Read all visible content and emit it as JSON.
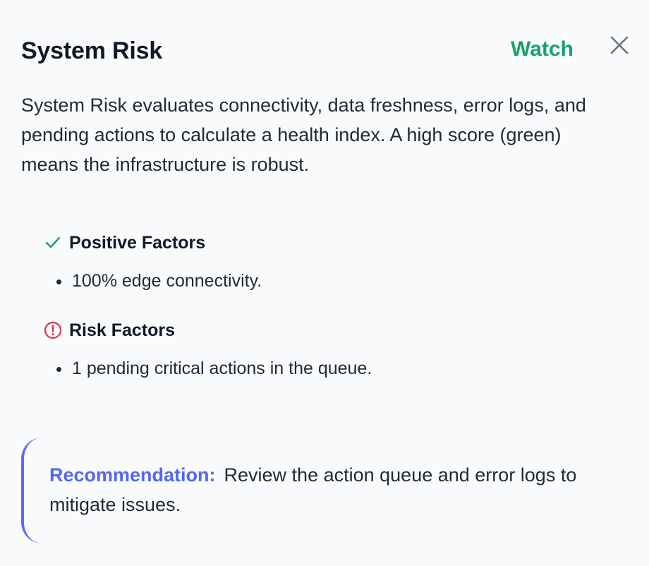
{
  "header": {
    "title": "System Risk",
    "status": "Watch",
    "close_icon": "close-icon"
  },
  "description": "System Risk evaluates connectivity, data freshness, error logs, and pending actions to calculate a health index. A high score (green) means the infrastructure is robust.",
  "positive": {
    "title": "Positive Factors",
    "icon": "check-icon",
    "items": [
      "100% edge connectivity."
    ]
  },
  "risk": {
    "title": "Risk Factors",
    "icon": "alert-circle-icon",
    "items": [
      "1 pending critical actions in the queue."
    ]
  },
  "recommendation": {
    "label": "Recommendation:",
    "text": "Review the action queue and error logs to mitigate issues."
  },
  "colors": {
    "status": "#16a36a",
    "positive_icon": "#16a36a",
    "risk_icon": "#dc3545",
    "accent": "#5467f0"
  }
}
